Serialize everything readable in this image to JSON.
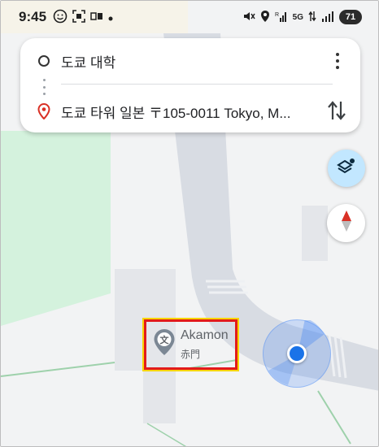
{
  "status_bar": {
    "time": "9:45",
    "signal_label": "5G",
    "battery": "71",
    "icons": [
      "face-emoji-icon",
      "screenshot-icon",
      "cast-icon",
      "dot-icon",
      "mute-icon",
      "location-icon",
      "wifi-icon",
      "data-transfer-icon",
      "signal-icon"
    ]
  },
  "route": {
    "origin": "도쿄 대학",
    "destination": "도쿄 타워 일본 〒105-0011 Tokyo, M...",
    "more_icon": "more-vert-icon",
    "swap_icon": "swap-vertical-icon"
  },
  "map_controls": {
    "layers_icon": "layers-icon",
    "compass_icon": "compass-icon"
  },
  "place": {
    "name": "Akamon",
    "subtitle": "赤門",
    "icon": "landmark-icon"
  },
  "colors": {
    "park": "#d4f2dd",
    "road": "#d8dce3",
    "building": "#e4e6ea",
    "accent_blue": "#1a73e8",
    "marker_red": "#d93025",
    "layers_bg": "#c2e7ff"
  }
}
